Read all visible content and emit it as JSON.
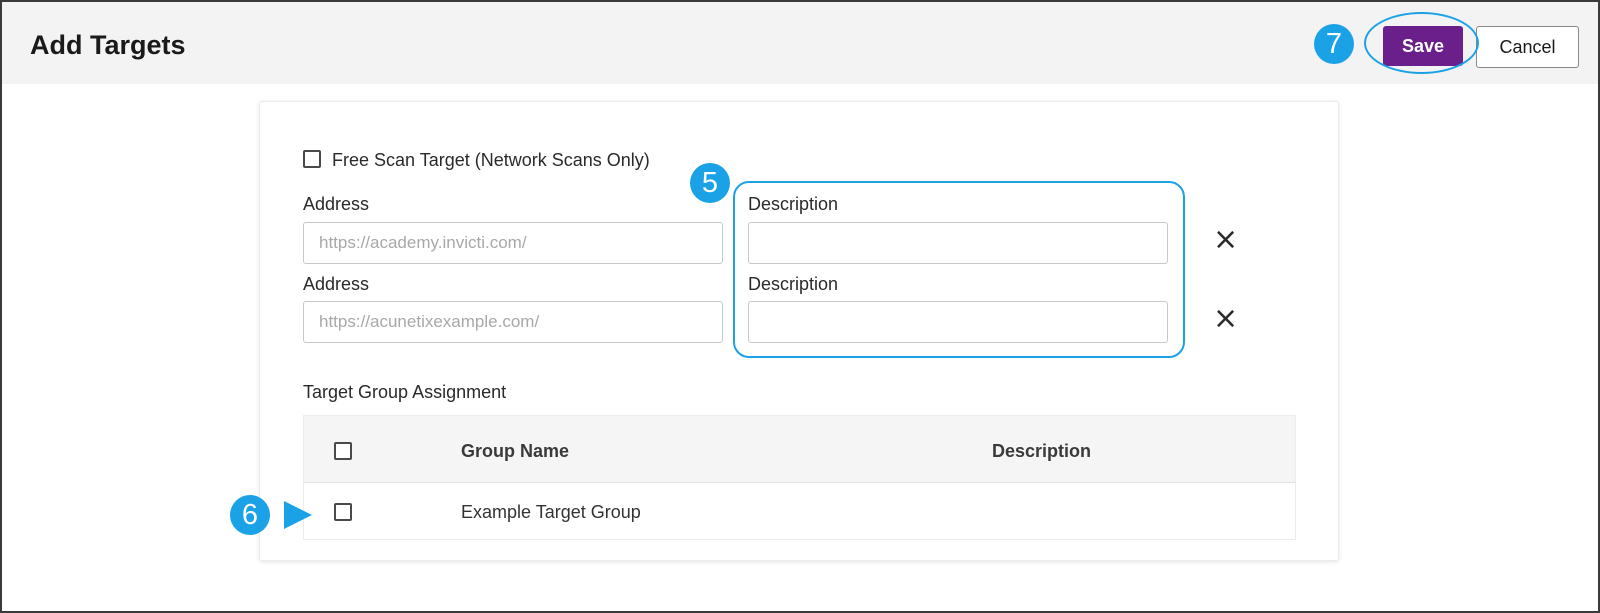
{
  "header": {
    "title": "Add Targets",
    "save_label": "Save",
    "cancel_label": "Cancel"
  },
  "callouts": {
    "save": "7",
    "description": "5",
    "group_checkbox": "6"
  },
  "form": {
    "free_scan_label": "Free Scan Target (Network Scans Only)",
    "free_scan_checked": false,
    "targets": [
      {
        "address_label": "Address",
        "address_placeholder": "https://academy.invicti.com/",
        "description_label": "Description",
        "description_value": ""
      },
      {
        "address_label": "Address",
        "address_placeholder": "https://acunetixexample.com/",
        "description_label": "Description",
        "description_value": ""
      }
    ],
    "remove_icon": "×"
  },
  "group_assignment": {
    "label": "Target Group Assignment",
    "columns": [
      "Group Name",
      "Description"
    ],
    "rows": [
      {
        "name": "Example Target Group",
        "description": "",
        "checked": false
      }
    ]
  },
  "colors": {
    "accent": "#6b1f8a",
    "callout": "#1ba2e6",
    "header_bg": "#f3f3f3"
  }
}
